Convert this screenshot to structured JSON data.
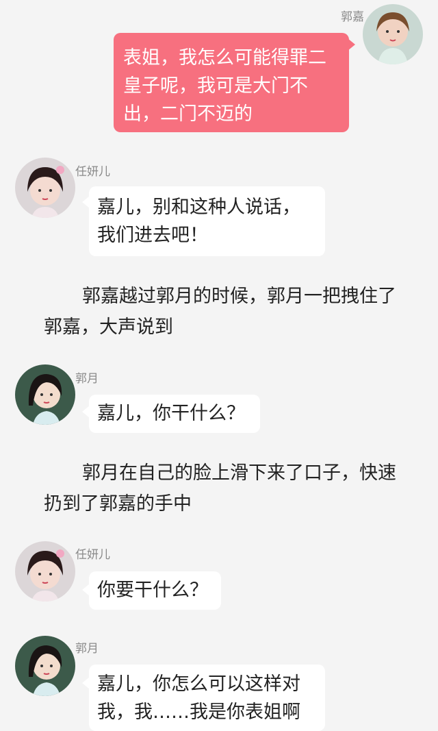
{
  "messages": [
    {
      "sender": "郭嘉",
      "text": "表姐，我怎么可能得罪二皇子呢，我可是大门不出，二门不迈的"
    },
    {
      "sender": "任妍儿",
      "text": "嘉儿，别和这种人说话，我们进去吧！"
    },
    {
      "sender": "郭月",
      "text": "嘉儿，你干什么？"
    },
    {
      "sender": "任妍儿",
      "text": "你要干什么？"
    },
    {
      "sender": "郭月",
      "text": "嘉儿，你怎么可以这样对我，我……我是你表姐啊"
    }
  ],
  "narration": [
    "郭嘉越过郭月的时候，郭月一把拽住了郭嘉，大声说到",
    "郭月在自己的脸上滑下来了口子，快速扔到了郭嘉的手中"
  ],
  "colors": {
    "right_bubble": "#f7707f",
    "left_bubble": "#ffffff",
    "background": "#f4f4f4"
  },
  "icons": {
    "guojia_avatar": "avatar-guojia-icon",
    "renyaner_avatar": "avatar-renyaner-icon",
    "guoyue_avatar": "avatar-guoyue-icon"
  }
}
